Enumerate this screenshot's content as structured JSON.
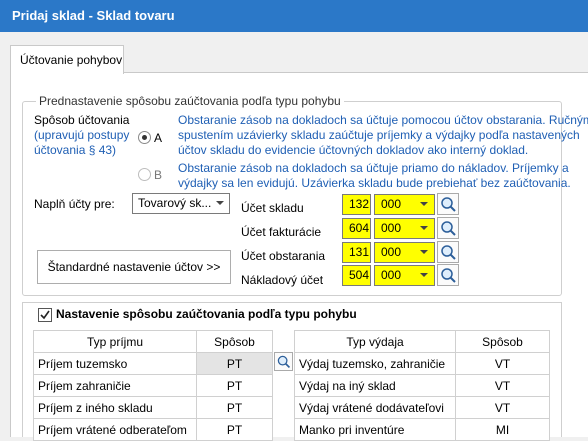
{
  "window": {
    "title": "Pridaj sklad - Sklad tovaru"
  },
  "tabs": [
    {
      "label": "Účtovanie pohybov"
    }
  ],
  "posting_group": {
    "title": "Prednastavenie spôsobu zaúčtovania podľa typu pohybu",
    "method_label": "Spôsob účtovania",
    "method_note": "(upravujú postupy\núčtovania § 43)",
    "option_a": {
      "label": "A",
      "selected": true,
      "description_line1": "Obstaranie zásob na dokladoch sa účtuje pomocou účtov obstarania. Ručným",
      "description_line2": "spustením uzávierky skladu zaúčtuje príjemky a výdajky podľa nastavených",
      "description_line3": "účtov skladu do evidencie účtovných dokladov ako interný doklad."
    },
    "option_b": {
      "label": "B",
      "selected": false,
      "description_line1": "Obstaranie zásob na dokladoch sa účtuje priamo do nákladov. Príjemky a",
      "description_line2": "výdajky sa len evidujú. Uzávierka skladu bude prebiehať bez zaúčtovania."
    },
    "fill_accounts_label": "Naplň účty pre:",
    "fill_accounts_value": "Tovarový sk...",
    "accounts": [
      {
        "label": "Účet skladu",
        "synthetic": "132",
        "analytic": "000"
      },
      {
        "label": "Účet fakturácie",
        "synthetic": "604",
        "analytic": "000"
      },
      {
        "label": "Účet obstarania",
        "synthetic": "131",
        "analytic": "000"
      },
      {
        "label": "Nákladový účet",
        "synthetic": "504",
        "analytic": "000"
      }
    ],
    "default_accounts_button": "Štandardné nastavenie účtov >>"
  },
  "movement_group": {
    "checked": true,
    "title": "Nastavenie spôsobu zaúčtovania podľa typu pohybu",
    "receipt_table": {
      "headers": [
        "Typ príjmu",
        "Spôsob"
      ],
      "rows": [
        [
          "Príjem tuzemsko",
          "PT"
        ],
        [
          "Príjem zahraničie",
          "PT"
        ],
        [
          "Príjem z iného skladu",
          "PT"
        ],
        [
          "Príjem vrátené odberateľom",
          "PT"
        ]
      ]
    },
    "issue_table": {
      "headers": [
        "Typ výdaja",
        "Spôsob"
      ],
      "rows": [
        [
          "Výdaj tuzemsko, zahraničie",
          "VT"
        ],
        [
          "Výdaj na iný sklad",
          "VT"
        ],
        [
          "Výdaj vrátené dodávateľovi",
          "VT"
        ],
        [
          "Manko pri inventúre",
          "MI"
        ]
      ]
    }
  },
  "colors": {
    "titlebar": "#2b78c8",
    "highlight_field": "#ffff00",
    "description_text": "#1f5fb4"
  },
  "icons": {
    "lookup": "search-icon",
    "checkbox": "checkmark-icon"
  }
}
